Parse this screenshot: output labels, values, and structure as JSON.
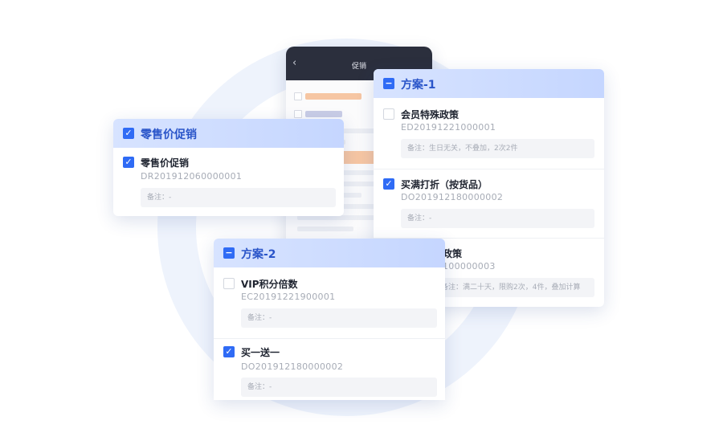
{
  "phone": {
    "back_icon": "chevron-left-icon",
    "title": "促销"
  },
  "cards": {
    "retail": {
      "header_title": "零售价促销",
      "item": {
        "name": "零售价促销",
        "code": "DR201912060000001",
        "note": "备注：-",
        "checked": true
      }
    },
    "plan1": {
      "header_title": "方案-1",
      "items": [
        {
          "name": "会员特殊政策",
          "code": "ED20191221000001",
          "note": "备注：生日无关，不叠加，2次2件",
          "checked": false
        },
        {
          "name": "买满打折（按货品）",
          "code": "DO201912180000002",
          "note": "备注：-",
          "checked": true
        },
        {
          "name": "政策",
          "code": "100000003",
          "note": "备注：满二十天，限购2次，4件，叠加计算",
          "checked": false
        }
      ]
    },
    "plan2": {
      "header_title": "方案-2",
      "items": [
        {
          "name": "VIP积分倍数",
          "code": "EC20191221900001",
          "note": "备注：-",
          "checked": false
        },
        {
          "name": "买一送一",
          "code": "DO201912180000002",
          "note": "备注：-",
          "checked": true
        }
      ]
    }
  },
  "colors": {
    "accent": "#2f6bf5",
    "header_gradient_start": "#d7e3ff",
    "header_gradient_end": "#c5d6ff",
    "phone_header": "#2b2f3d",
    "phone_band": "#f6c6a3"
  }
}
